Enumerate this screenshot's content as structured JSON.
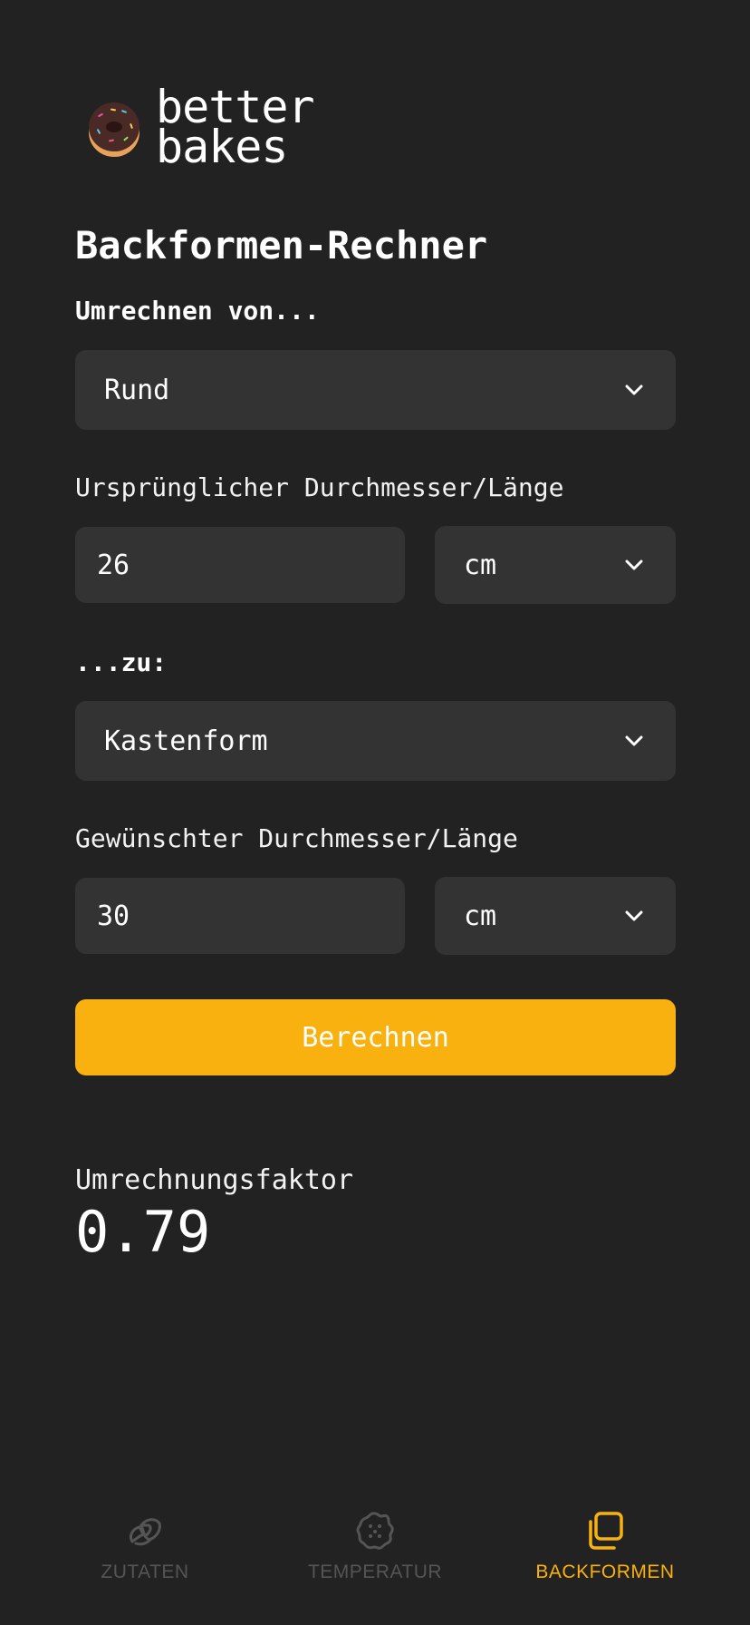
{
  "app": {
    "logo_line1": "better",
    "logo_line2": "bakes"
  },
  "page": {
    "title": "Backformen-Rechner"
  },
  "from": {
    "heading": "Umrechnen von...",
    "shape_value": "Rund",
    "size_label": "Ursprünglicher Durchmesser/Länge",
    "size_value": "26",
    "unit_value": "cm"
  },
  "to": {
    "heading": "...zu:",
    "shape_value": "Kastenform",
    "size_label": "Gewünschter Durchmesser/Länge",
    "size_value": "30",
    "unit_value": "cm"
  },
  "action": {
    "calculate_label": "Berechnen"
  },
  "result": {
    "label": "Umrechnungsfaktor",
    "value": "0.79"
  },
  "nav": {
    "items": [
      {
        "label": "ZUTATEN",
        "icon": "croissant-icon",
        "active": false
      },
      {
        "label": "TEMPERATUR",
        "icon": "cookie-icon",
        "active": false
      },
      {
        "label": "BACKFORMEN",
        "icon": "baking-pans-icon",
        "active": true
      }
    ]
  },
  "colors": {
    "background": "#222222",
    "field": "#333333",
    "accent": "#f9b110",
    "inactive_nav": "#555555"
  }
}
